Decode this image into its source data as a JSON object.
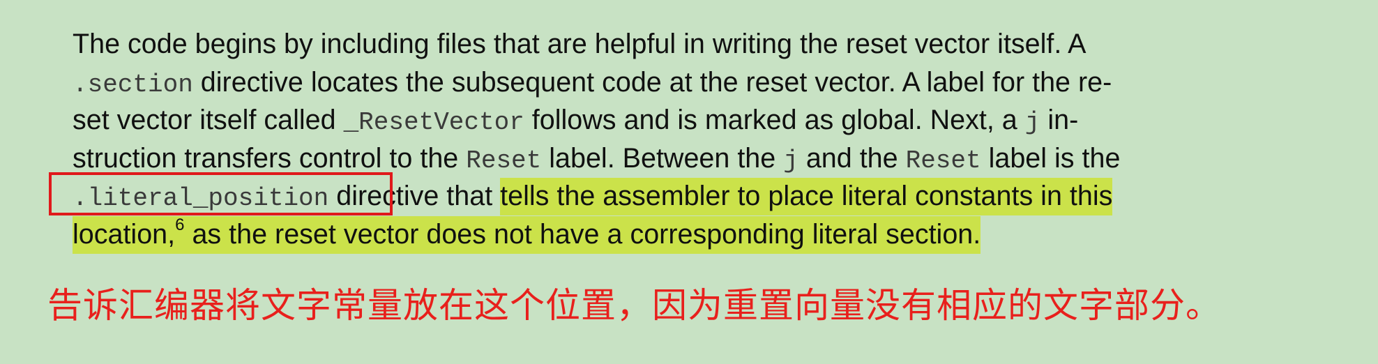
{
  "paragraph": {
    "l1": "The code begins by including files that are helpful in writing the reset vector itself. A",
    "l2_code": ".section",
    "l2_text": " directive locates the subsequent code at the reset vector. A label for the re-",
    "l3_a": "set vector itself called ",
    "l3_code1": "_ResetVector",
    "l3_b": " follows and is marked as global. Next, a ",
    "l3_code2": "j",
    "l3_c": " in-",
    "l4_a": "struction transfers control to the ",
    "l4_code1": "Reset",
    "l4_b": " label. Between the ",
    "l4_code2": "j",
    "l4_c": " and the ",
    "l4_code3": "Reset",
    "l4_d": " label is the",
    "l5_code": ".literal_position",
    "l5_a": " directive that ",
    "l5_hl": "tells the assembler to place literal constants in this",
    "l6_hl_a": "location,",
    "l6_sup": "6",
    "l6_hl_b": " as the reset vector does not have a corresponding literal section."
  },
  "annotation": {
    "box_color": "#e0191b",
    "translation": "告诉汇编器将文字常量放在这个位置，因为重置向量没有相应的文字部分。",
    "translation_color": "#e8201c"
  },
  "colors": {
    "background": "#c8e2c4",
    "highlight": "#cbe24a"
  }
}
